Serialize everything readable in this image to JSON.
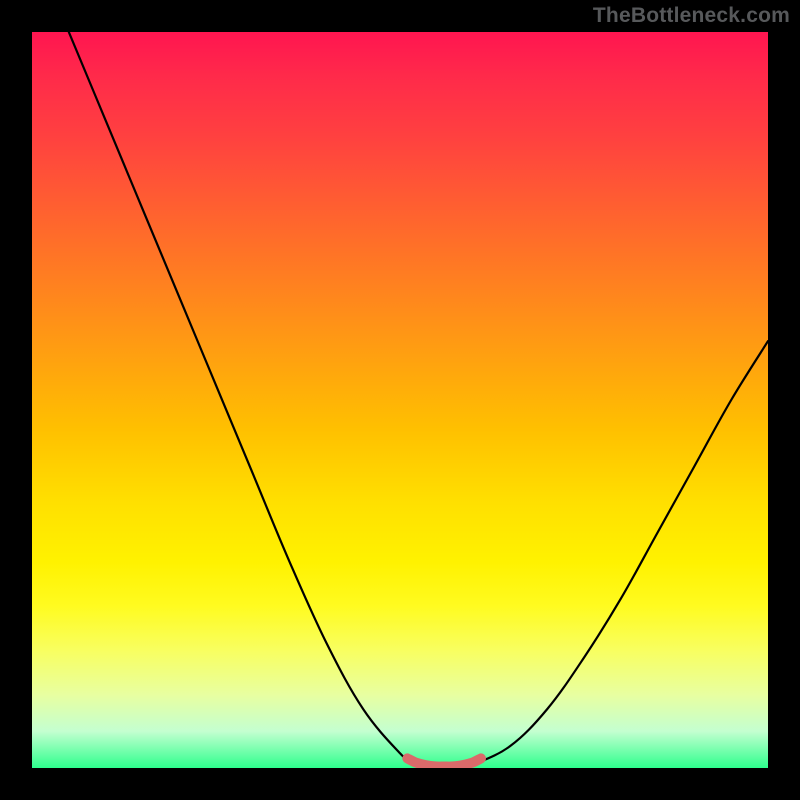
{
  "watermark": "TheBottleneck.com",
  "chart_data": {
    "type": "line",
    "title": "",
    "xlabel": "",
    "ylabel": "",
    "xlim": [
      0,
      100
    ],
    "ylim": [
      0,
      100
    ],
    "series": [
      {
        "name": "bottleneck-curve",
        "x": [
          5,
          10,
          15,
          20,
          25,
          30,
          35,
          40,
          45,
          50,
          52,
          54,
          56,
          58,
          60,
          65,
          70,
          75,
          80,
          85,
          90,
          95,
          100
        ],
        "y": [
          100,
          88,
          76,
          64,
          52,
          40,
          28,
          17,
          8,
          2,
          0.5,
          0,
          0,
          0,
          0.5,
          3,
          8,
          15,
          23,
          32,
          41,
          50,
          58
        ]
      },
      {
        "name": "optimal-flat-zone",
        "x": [
          51,
          52,
          53,
          54,
          55,
          56,
          57,
          58,
          59,
          60,
          61
        ],
        "y": [
          1.3,
          0.8,
          0.5,
          0.3,
          0.2,
          0.2,
          0.2,
          0.3,
          0.5,
          0.8,
          1.3
        ]
      }
    ],
    "background_gradient": {
      "top": "#ff1550",
      "mid": "#ffe000",
      "bottom": "#2eff8d"
    }
  }
}
